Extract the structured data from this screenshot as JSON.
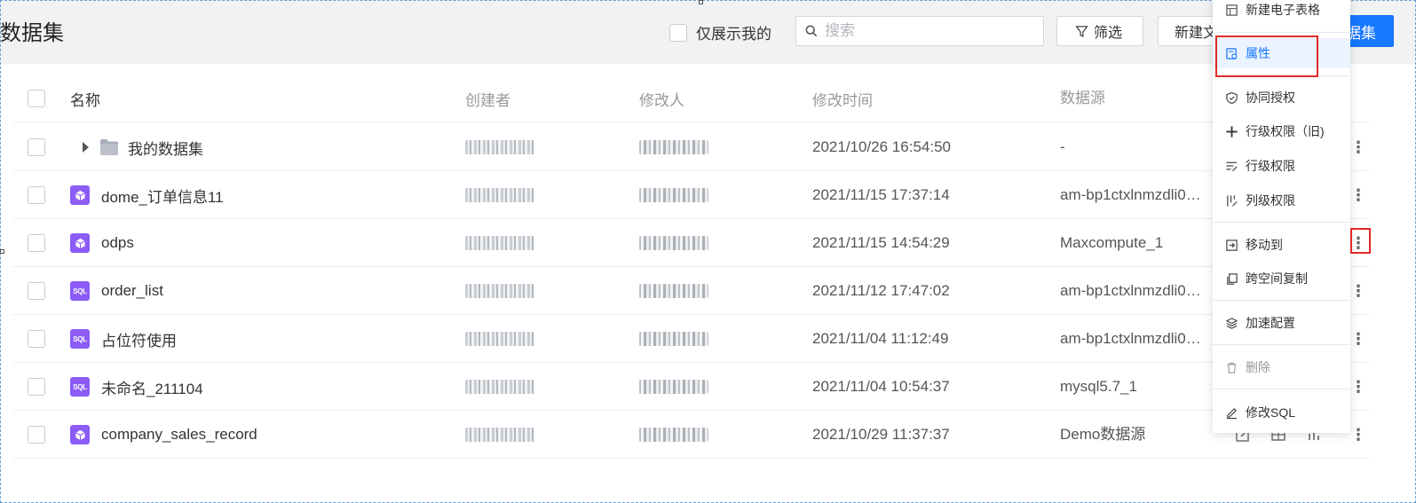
{
  "header": {
    "title": "数据集",
    "only_mine_label": "仅展示我的",
    "search_placeholder": "搜索",
    "filter_label": "筛选",
    "new_label": "新建文",
    "primary_label": "据集"
  },
  "table": {
    "columns": {
      "name": "名称",
      "creator": "创建者",
      "modifier": "修改人",
      "time": "修改时间",
      "source": "数据源"
    },
    "rows": [
      {
        "name": "我的数据集",
        "type": "folder",
        "time": "2021/10/26 16:54:50",
        "source": "-"
      },
      {
        "name": "dome_订单信息11",
        "type": "cube",
        "time": "2021/11/15 17:37:14",
        "source": "am-bp1ctxlnmzdli0…"
      },
      {
        "name": "odps",
        "type": "cube",
        "time": "2021/11/15 14:54:29",
        "source": "Maxcompute_1"
      },
      {
        "name": "order_list",
        "type": "sql",
        "time": "2021/11/12 17:47:02",
        "source": "am-bp1ctxlnmzdli0…"
      },
      {
        "name": "占位符使用",
        "type": "sql",
        "time": "2021/11/04 11:12:49",
        "source": "am-bp1ctxlnmzdli0…"
      },
      {
        "name": "未命名_211104",
        "type": "sql",
        "time": "2021/11/04 10:54:37",
        "source": "mysql5.7_1"
      },
      {
        "name": "company_sales_record",
        "type": "cube",
        "time": "2021/10/29 11:37:37",
        "source": "Demo数据源"
      }
    ],
    "sql_icon_text": "SQL",
    "more_glyph": "⋮"
  },
  "menu": {
    "items": [
      {
        "label": "新建电子表格",
        "icon": "table-icon"
      },
      {
        "label": "属性",
        "icon": "properties-icon",
        "active": true
      },
      {
        "label": "协同授权",
        "icon": "shield-icon"
      },
      {
        "label": "行级权限（旧)",
        "icon": "plus-icon"
      },
      {
        "label": "行级权限",
        "icon": "row-permission-icon"
      },
      {
        "label": "列级权限",
        "icon": "column-permission-icon"
      },
      {
        "label": "移动到",
        "icon": "move-icon"
      },
      {
        "label": "跨空间复制",
        "icon": "copy-icon"
      },
      {
        "label": "加速配置",
        "icon": "accelerate-icon"
      },
      {
        "label": "删除",
        "icon": "trash-icon",
        "disabled": true
      },
      {
        "label": "修改SQL",
        "icon": "edit-icon"
      }
    ]
  },
  "colors": {
    "accent": "#1677ff",
    "dataset_icon": "#8b5cf6",
    "highlight": "#e02a2a"
  }
}
